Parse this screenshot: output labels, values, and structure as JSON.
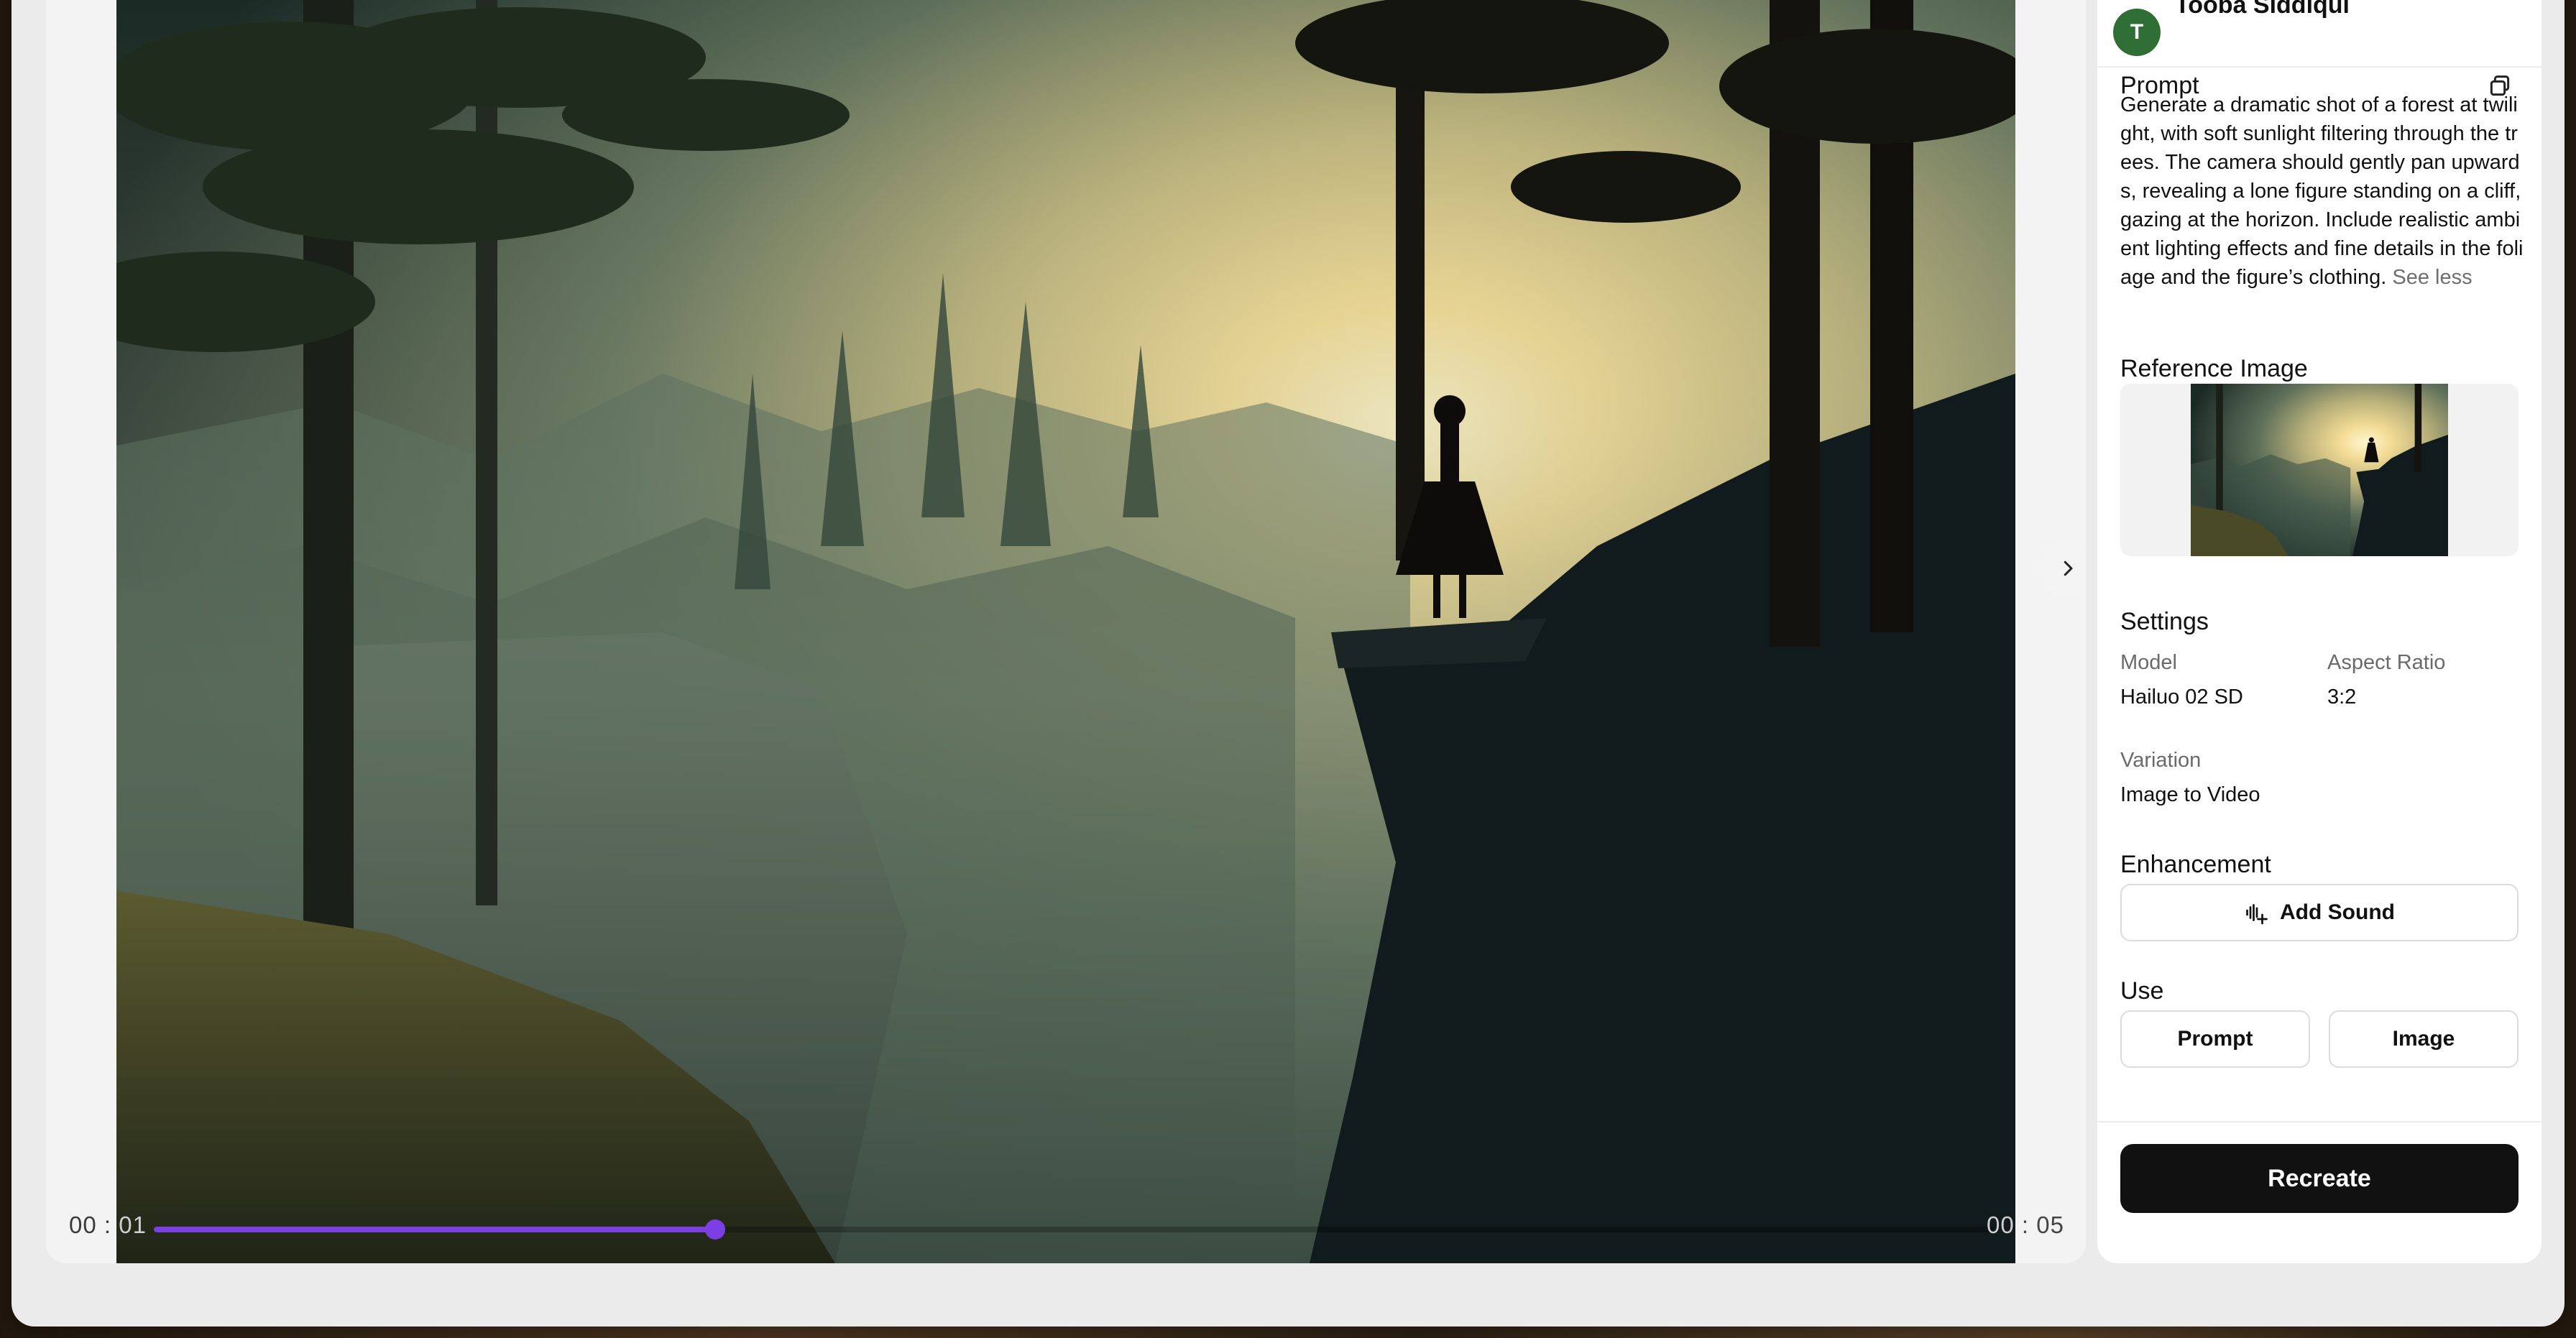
{
  "player": {
    "time_current_lead": "00 : ",
    "time_current_tail": "01",
    "time_total_lead": "00",
    "time_total_tail": " : 05",
    "progress": 0.305,
    "accent_color": "#7b3fe4"
  },
  "user": {
    "avatar_initial": "T",
    "name": "Tooba Siddiqui"
  },
  "prompt": {
    "title": "Prompt",
    "text": "Generate a dramatic shot of a forest at twilight, with soft sunlight filtering through the trees. The camera should gently pan upwards, revealing a lone figure standing on a cliff, gazing at the horizon. Include realistic ambient lighting effects and fine details in the foliage and the figure’s clothing.",
    "see_less": "See less",
    "copy_icon": "copy-icon"
  },
  "reference": {
    "title": "Reference Image"
  },
  "settings": {
    "title": "Settings",
    "model_label": "Model",
    "model_value": "Hailuo 02 SD",
    "aspect_label": "Aspect Ratio",
    "aspect_value": "3:2",
    "variation_label": "Variation",
    "variation_value": "Image to Video"
  },
  "enhancement": {
    "title": "Enhancement",
    "add_sound_label": "Add Sound",
    "add_sound_icon": "sound-wave-plus-icon"
  },
  "use": {
    "title": "Use",
    "prompt_button": "Prompt",
    "image_button": "Image"
  },
  "actions": {
    "recreate_label": "Recreate"
  }
}
